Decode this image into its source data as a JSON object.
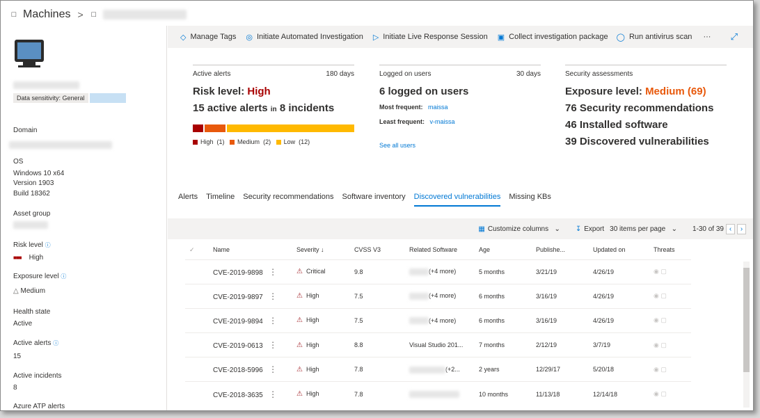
{
  "breadcrumb": {
    "root": "Machines",
    "machine_icon": "laptop-icon"
  },
  "left_panel": {
    "data_sensitivity": "Data sensitivity: General",
    "fields": {
      "domain_label": "Domain",
      "os_label": "OS",
      "os_line1": "Windows 10 x64",
      "os_line2": "Version 1903",
      "os_line3": "Build 18362",
      "asset_group_label": "Asset group",
      "risk_level_label": "Risk level",
      "risk_level_value": "High",
      "exposure_level_label": "Exposure level",
      "exposure_level_value": "Medium",
      "health_state_label": "Health state",
      "health_state_value": "Active",
      "active_alerts_label": "Active alerts",
      "active_alerts_value": "15",
      "active_incidents_label": "Active incidents",
      "active_incidents_value": "8",
      "azure_label": "Azure ATP alerts"
    }
  },
  "toolbar": {
    "manage_tags": "Manage Tags",
    "initiate_investigation": "Initiate Automated Investigation",
    "live_response": "Initiate Live Response Session",
    "collect_package": "Collect investigation package",
    "run_av": "Run antivirus scan",
    "more": "···"
  },
  "cards": {
    "alerts": {
      "title": "Active alerts",
      "period": "180 days",
      "risk_prefix": "Risk level: ",
      "risk_value": "High",
      "alerts_count_text": "15 active alerts",
      "in_text": "in",
      "incidents_text": "8 incidents",
      "legend": [
        {
          "label": "High",
          "count": "(1)",
          "color": "#a80000"
        },
        {
          "label": "Medium",
          "count": "(2)",
          "color": "#e8590c"
        },
        {
          "label": "Low",
          "count": "(12)",
          "color": "#ffb900"
        }
      ],
      "bar": {
        "high": 1,
        "medium": 2,
        "low": 12
      }
    },
    "users": {
      "title": "Logged on users",
      "period": "30 days",
      "headline": "6 logged on users",
      "most_label": "Most frequent:",
      "most_value": "maissa",
      "least_label": "Least frequent:",
      "least_value": "v-maissa",
      "see_all": "See all users"
    },
    "security": {
      "title": "Security assessments",
      "exposure_prefix": "Exposure level: ",
      "exposure_value": "Medium (69)",
      "line1": "76 Security recommendations",
      "line2": "46 Installed software",
      "line3": "39 Discovered vulnerabilities"
    }
  },
  "tabs": [
    "Alerts",
    "Timeline",
    "Security recommendations",
    "Software inventory",
    "Discovered vulnerabilities",
    "Missing KBs"
  ],
  "active_tab": "Discovered vulnerabilities",
  "grid_toolbar": {
    "customize": "Customize columns",
    "export": "Export",
    "per_page": "30 items per page",
    "pagination": "1-30 of 39"
  },
  "table": {
    "headers": [
      "Name",
      "Severity",
      "CVSS V3",
      "Related Software",
      "Age",
      "Publishe...",
      "Updated on",
      "Threats"
    ],
    "rows": [
      {
        "name": "CVE-2019-9898",
        "severity": "Critical",
        "cvss": "9.8",
        "software": "(+4 more)",
        "age": "5 months",
        "published": "3/21/19",
        "updated": "4/26/19"
      },
      {
        "name": "CVE-2019-9897",
        "severity": "High",
        "cvss": "7.5",
        "software": "(+4 more)",
        "age": "6 months",
        "published": "3/16/19",
        "updated": "4/26/19"
      },
      {
        "name": "CVE-2019-9894",
        "severity": "High",
        "cvss": "7.5",
        "software": "(+4 more)",
        "age": "6 months",
        "published": "3/16/19",
        "updated": "4/26/19"
      },
      {
        "name": "CVE-2019-0613",
        "severity": "High",
        "cvss": "8.8",
        "software": "Visual Studio 201...",
        "age": "7 months",
        "published": "2/12/19",
        "updated": "3/7/19"
      },
      {
        "name": "CVE-2018-5996",
        "severity": "High",
        "cvss": "7.8",
        "software": "(+2...",
        "age": "2 years",
        "published": "12/29/17",
        "updated": "5/20/18"
      },
      {
        "name": "CVE-2018-3635",
        "severity": "High",
        "cvss": "7.8",
        "software": "",
        "age": "10 months",
        "published": "11/13/18",
        "updated": "12/14/18"
      }
    ]
  }
}
